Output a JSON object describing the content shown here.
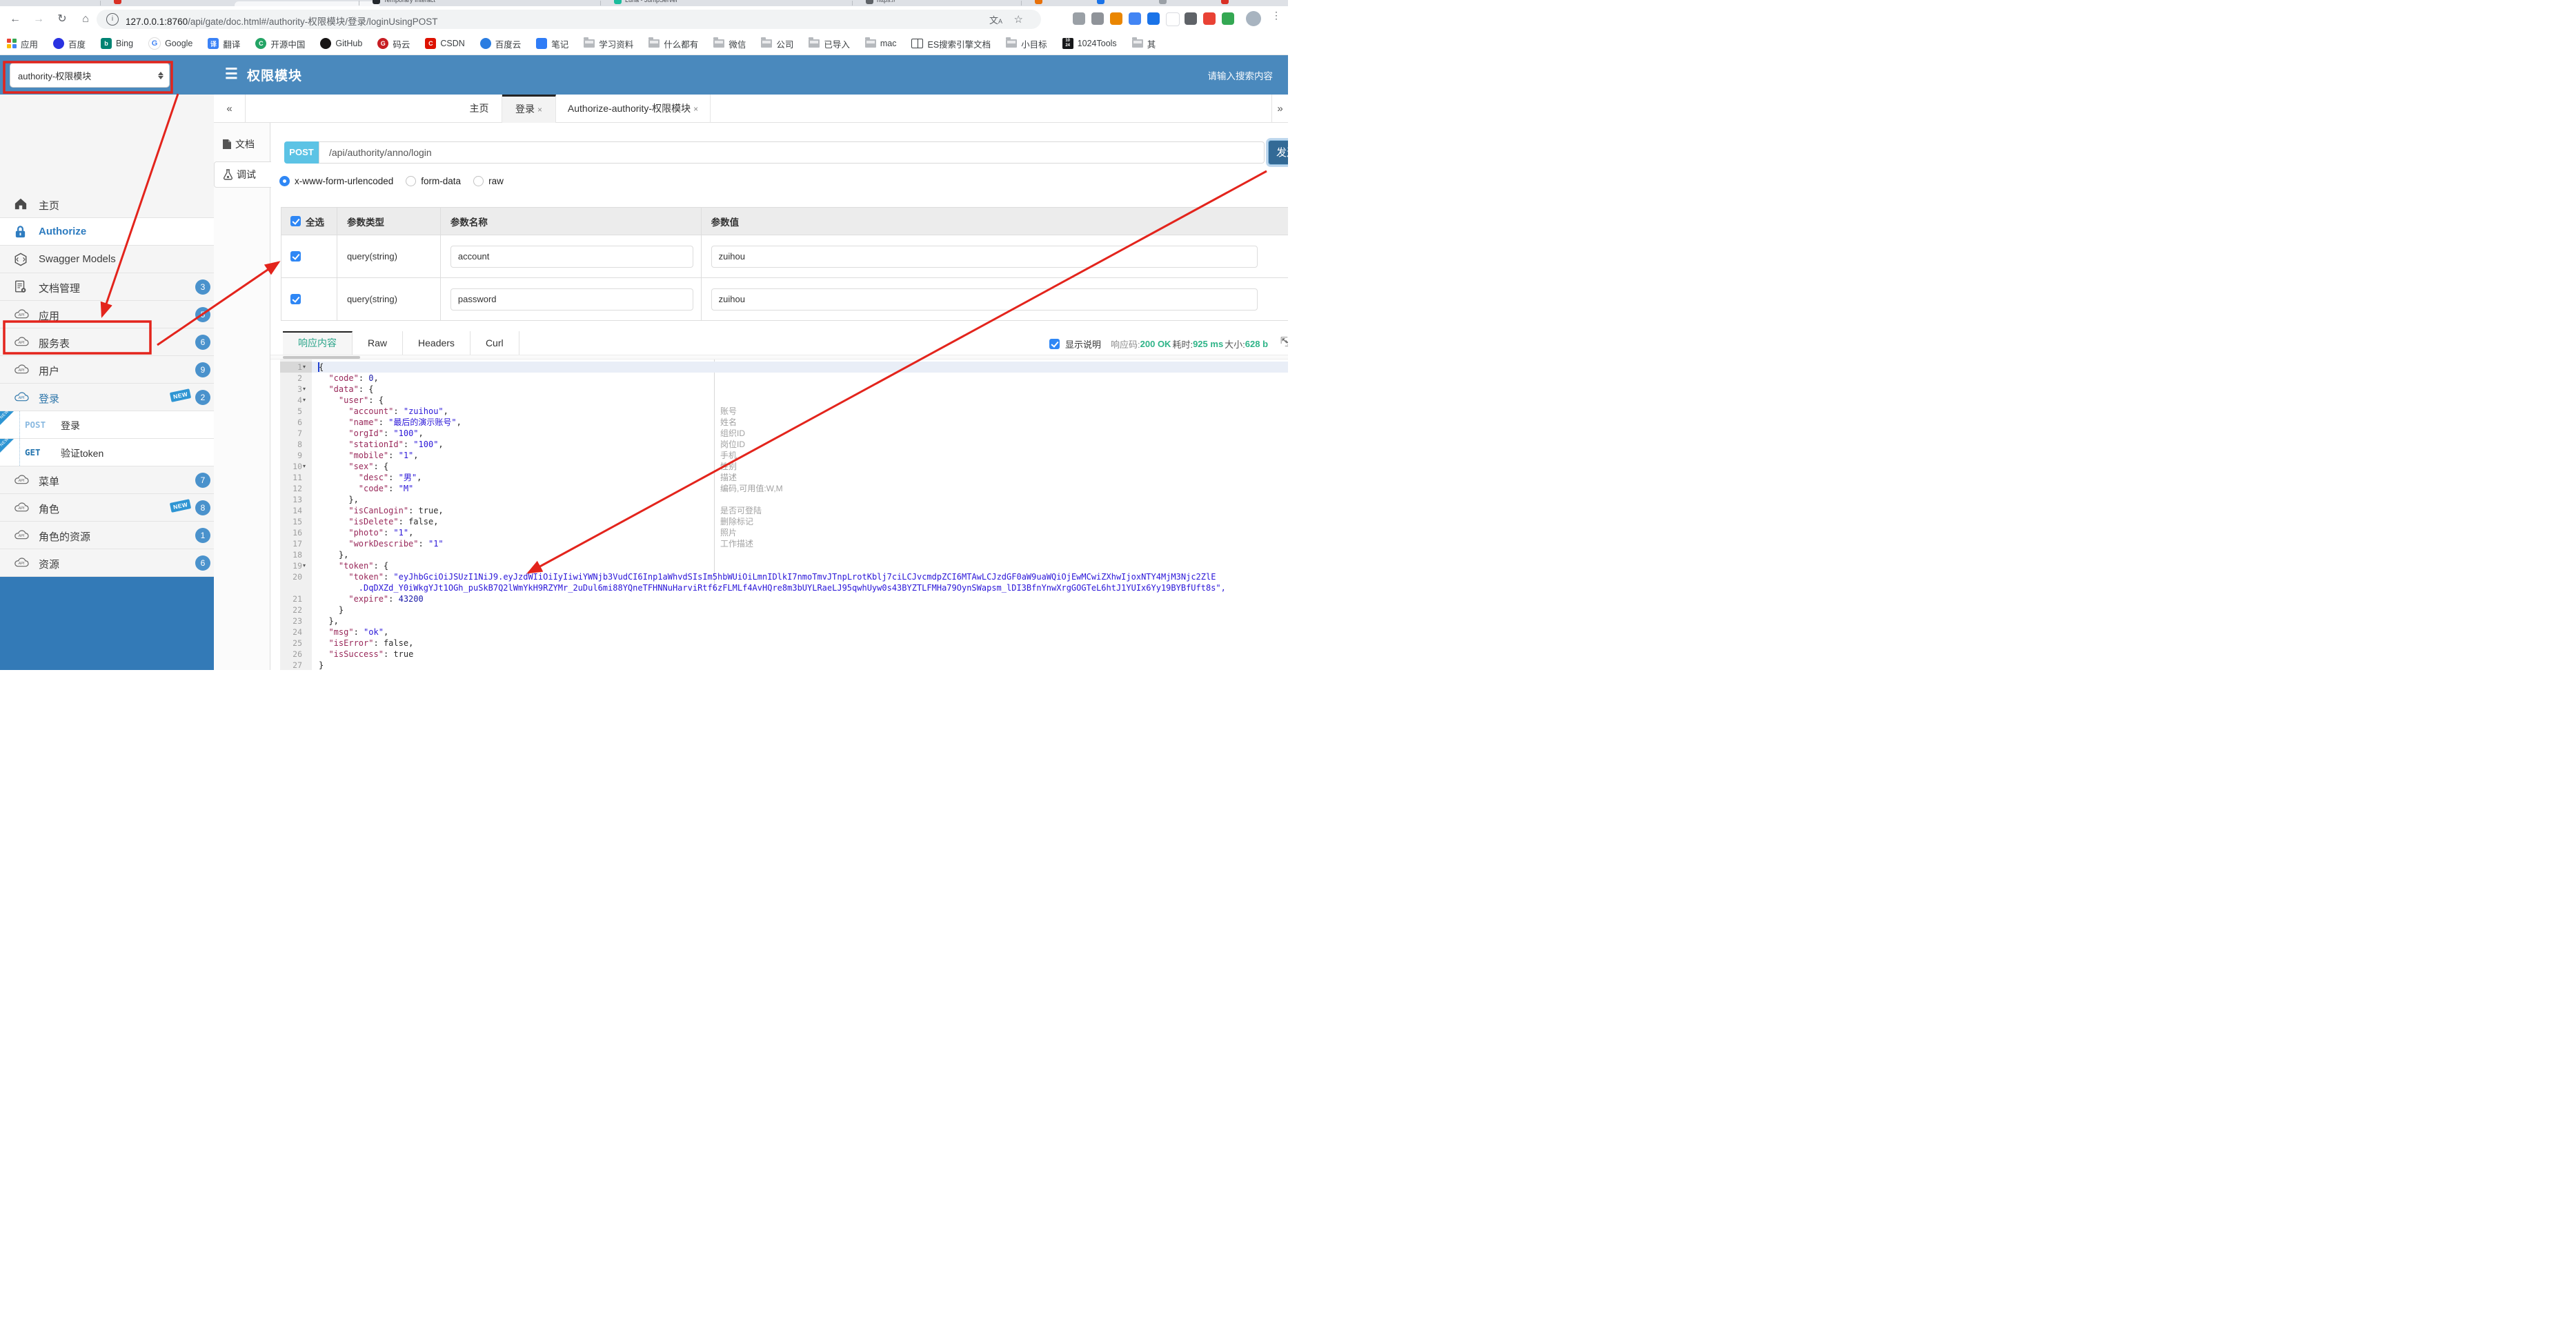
{
  "accent": {
    "header_blue": "#4a89bd",
    "primary_blue": "#337ab7",
    "post_badge": "#5cc3e5",
    "badge_blue": "#4a92cc",
    "new_blue": "#2e95d3",
    "success_green": "#2eb488",
    "active_teal": "#2aa489",
    "annotation_red": "#e3241c"
  },
  "browser": {
    "url": {
      "host": "127.0.0.1:8760",
      "path": "/api/gate/doc.html#/authority-权限模块/登录/loginUsingPOST"
    },
    "tab_fragments": [
      {
        "title": "",
        "color": "#d93025"
      },
      {
        "title": "Temporary Interact",
        "color": "#24292e"
      },
      {
        "title": "Luna - JumpServer",
        "color": "#1abc9c"
      },
      {
        "title": "https://",
        "color": "#5f6368"
      },
      {
        "title": "",
        "color": "#e8710a"
      },
      {
        "title": "",
        "color": "#1a73e8"
      },
      {
        "title": "",
        "color": "#9aa0a6"
      },
      {
        "title": "",
        "color": "#d93025"
      }
    ],
    "bookmarks": [
      {
        "label": "应用",
        "icon": "apps"
      },
      {
        "label": "百度",
        "icon": "circle",
        "color": "#2932e1",
        "glyph": ""
      },
      {
        "label": "Bing",
        "icon": "square",
        "color": "#008373",
        "glyph": "b"
      },
      {
        "label": "Google",
        "icon": "google",
        "glyph": "G"
      },
      {
        "label": "翻译",
        "icon": "square",
        "color": "#3b82f6",
        "glyph": "译"
      },
      {
        "label": "开源中国",
        "icon": "circle",
        "color": "#24a465",
        "glyph": "C"
      },
      {
        "label": "GitHub",
        "icon": "circle",
        "color": "#171515",
        "glyph": ""
      },
      {
        "label": "码云",
        "icon": "circle",
        "color": "#c71d23",
        "glyph": "G"
      },
      {
        "label": "CSDN",
        "icon": "square",
        "color": "#dd1100",
        "glyph": "C"
      },
      {
        "label": "百度云",
        "icon": "circle",
        "color": "#2b7de1",
        "glyph": ""
      },
      {
        "label": "笔记",
        "icon": "square",
        "color": "#2f7cf6",
        "glyph": ""
      },
      {
        "label": "学习资料",
        "icon": "folder"
      },
      {
        "label": "什么都有",
        "icon": "folder"
      },
      {
        "label": "微信",
        "icon": "folder"
      },
      {
        "label": "公司",
        "icon": "folder"
      },
      {
        "label": "已导入",
        "icon": "folder"
      },
      {
        "label": "mac",
        "icon": "folder"
      },
      {
        "label": "ES搜索引擎文档",
        "icon": "book"
      },
      {
        "label": "小目标",
        "icon": "folder"
      },
      {
        "label": "1024Tools",
        "icon": "chip1024"
      },
      {
        "label": "其",
        "icon": "folder"
      }
    ]
  },
  "header": {
    "module_select_value": "authority-权限模块",
    "title": "权限模块",
    "search_placeholder": "请输入搜索内容"
  },
  "sidebar": {
    "items": [
      {
        "label": "主页",
        "icon": "home-icon"
      },
      {
        "label": "Authorize",
        "icon": "lock-icon",
        "style": "auth white"
      },
      {
        "label": "Swagger Models",
        "icon": "hexagon-icon"
      },
      {
        "label": "文档管理",
        "icon": "doc-gear-icon",
        "badge": "3"
      },
      {
        "label": "应用",
        "icon": "cloud-api-icon",
        "badge": "5"
      },
      {
        "label": "服务表",
        "icon": "cloud-api-icon",
        "badge": "6"
      },
      {
        "label": "用户",
        "icon": "cloud-api-icon",
        "badge": "9"
      },
      {
        "label": "登录",
        "icon": "cloud-api-icon",
        "badge": "2",
        "new": true,
        "style": "open"
      },
      {
        "type": "child",
        "method": "POST",
        "label": "登录",
        "selected": true,
        "ribbon": "NEW"
      },
      {
        "type": "child",
        "method": "GET",
        "label": "验证token",
        "ribbon": "NEW"
      },
      {
        "label": "菜单",
        "icon": "cloud-api-icon",
        "badge": "7"
      },
      {
        "label": "角色",
        "icon": "cloud-api-icon",
        "badge": "8",
        "new": true
      },
      {
        "label": "角色的资源",
        "icon": "cloud-api-icon",
        "badge": "1"
      },
      {
        "label": "资源",
        "icon": "cloud-api-icon",
        "badge": "6"
      }
    ]
  },
  "tabbar": {
    "collapse": "«",
    "more": "»",
    "tabs": [
      {
        "label": "主页",
        "close": false,
        "active": false
      },
      {
        "label": "登录",
        "close": true,
        "active": true
      },
      {
        "label": "Authorize-authority-权限模块",
        "close": true,
        "active": false
      }
    ]
  },
  "subnav": {
    "doc": "文档",
    "debug": "调试"
  },
  "request": {
    "method": "POST",
    "url": "/api/authority/anno/login",
    "send_label": "发送",
    "body_types": [
      "x-www-form-urlencoded",
      "form-data",
      "raw"
    ],
    "selected_body_type": "x-www-form-urlencoded"
  },
  "params": {
    "headers": [
      "全选",
      "参数类型",
      "参数名称",
      "参数值"
    ],
    "rows": [
      {
        "checked": true,
        "type": "query(string)",
        "name": "account",
        "value": "zuihou"
      },
      {
        "checked": true,
        "type": "query(string)",
        "name": "password",
        "value": "zuihou"
      }
    ]
  },
  "response": {
    "tabs": [
      "响应内容",
      "Raw",
      "Headers",
      "Curl"
    ],
    "active_tab": "响应内容",
    "show_desc_label": "显示说明",
    "show_desc_checked": true,
    "code_label": "响应码:",
    "code_value": "200 OK",
    "time_label": "耗时:",
    "time_value": "925 ms",
    "size_label": "大小:",
    "size_value": "628 b"
  },
  "editor": {
    "fold_lines": [
      1,
      3,
      4,
      10,
      19
    ],
    "lines": [
      {
        "n": 1,
        "code": "{",
        "active": true
      },
      {
        "n": 2,
        "code": "  \"code\": 0,"
      },
      {
        "n": 3,
        "code": "  \"data\": {"
      },
      {
        "n": 4,
        "code": "    \"user\": {"
      },
      {
        "n": 5,
        "code": "      \"account\": \"zuihou\","
      },
      {
        "n": 6,
        "code": "      \"name\": \"最后的演示账号\","
      },
      {
        "n": 7,
        "code": "      \"orgId\": \"100\","
      },
      {
        "n": 8,
        "code": "      \"stationId\": \"100\","
      },
      {
        "n": 9,
        "code": "      \"mobile\": \"1\","
      },
      {
        "n": 10,
        "code": "      \"sex\": {"
      },
      {
        "n": 11,
        "code": "        \"desc\": \"男\","
      },
      {
        "n": 12,
        "code": "        \"code\": \"M\""
      },
      {
        "n": 13,
        "code": "      },"
      },
      {
        "n": 14,
        "code": "      \"isCanLogin\": true,"
      },
      {
        "n": 15,
        "code": "      \"isDelete\": false,"
      },
      {
        "n": 16,
        "code": "      \"photo\": \"1\","
      },
      {
        "n": 17,
        "code": "      \"workDescribe\": \"1\""
      },
      {
        "n": 18,
        "code": "    },"
      },
      {
        "n": 19,
        "code": "    \"token\": {"
      },
      {
        "n": 20,
        "segs": [
          {
            "t": "      ",
            "c": ""
          },
          {
            "t": "\"token\"",
            "c": "tk"
          },
          {
            "t": ": ",
            "c": ""
          },
          {
            "t": "\"eyJhbGciOiJSUzI1NiJ9.eyJzdWIiOiIyIiwiYWNjb3VudCI6Inp1aWhvdSIsIm5hbWUiOiLmnIDlkI7nmoTmvJTnpLrotKblj7ciLCJvcmdpZCI6MTAwLCJzdGF0aW9uaWQiOjEwMCwiZXhwIjoxNTY4MjM3Njc2ZlE",
            "c": "ts"
          }
        ]
      },
      {
        "n": null,
        "segs": [
          {
            "t": "        ",
            "c": ""
          },
          {
            "t": ".DqDXZd_Y0iWkgYJt1OGh_puSkB7Q2lWmYkH9RZYMr_2uDul6mi88YQneTFHNNuHarviRtf6zFLMLf4AvHQre8m3bUYLRaeLJ95qwhUyw0s43BYZTLFMHa79OynSWapsm_lDI3BfnYnwXrgGOGTeL6htJ1YUIx6Yy19BYBfUft8s\",",
            "c": "ts"
          }
        ]
      },
      {
        "n": 21,
        "code": "      \"expire\": 43200"
      },
      {
        "n": 22,
        "code": "    }"
      },
      {
        "n": 23,
        "code": "  },"
      },
      {
        "n": 24,
        "code": "  \"msg\": \"ok\","
      },
      {
        "n": 25,
        "code": "  \"isError\": false,"
      },
      {
        "n": 26,
        "code": "  \"isSuccess\": true"
      },
      {
        "n": 27,
        "code": "}"
      }
    ],
    "annotations": [
      {
        "line": 5,
        "text": "账号"
      },
      {
        "line": 6,
        "text": "姓名"
      },
      {
        "line": 7,
        "text": "组织ID"
      },
      {
        "line": 8,
        "text": "岗位ID"
      },
      {
        "line": 9,
        "text": "手机"
      },
      {
        "line": 10,
        "text": "性别"
      },
      {
        "line": 11,
        "text": "描述"
      },
      {
        "line": 12,
        "text": "编码,可用值:W,M"
      },
      {
        "line": 14,
        "text": "是否可登陆"
      },
      {
        "line": 15,
        "text": "删除标记"
      },
      {
        "line": 16,
        "text": "照片"
      },
      {
        "line": 17,
        "text": "工作描述"
      }
    ]
  }
}
